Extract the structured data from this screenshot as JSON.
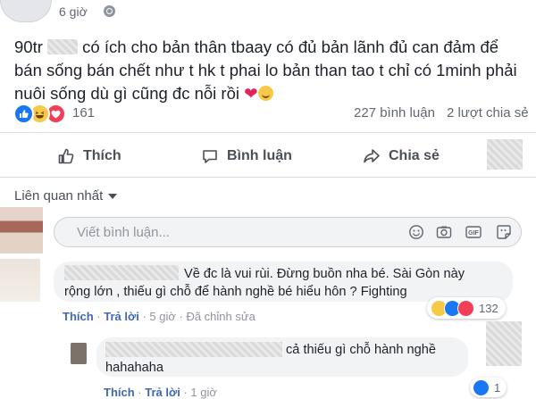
{
  "post": {
    "time": "6 giờ",
    "text_prefix": "90tr",
    "text_mid": "có ích cho bản thân tbaay có đủ bản lãnh đủ can đảm để bán sống bán chết như t hk t phai lo bản than tao t chỉ có 1minh phải nuôi sống dù gì cũng đc nỗi rồi",
    "heart": "❤",
    "reaction_count": "161",
    "comment_count": "227 bình luận",
    "share_count": "2 lượt chia sẻ"
  },
  "actions": {
    "like": "Thích",
    "comment": "Bình luận",
    "share": "Chia sẻ"
  },
  "filter": {
    "label": "Liên quan nhất"
  },
  "composer": {
    "placeholder": "Viết bình luận..."
  },
  "comments": [
    {
      "text": "Về đc là vui rùi. Đừng buồn nha bé. Sài Gòn này rộng lớn , thiếu gì chỗ để hành nghề bé hiểu hôn ? Fighting",
      "like": "Thích",
      "reply": "Trả lời",
      "time": "5 giờ",
      "edited": "Đã chỉnh sửa",
      "reaction_count": "132"
    },
    {
      "text": "cả thiếu gì chỗ hành nghề hahahaha",
      "like": "Thích",
      "reply": "Trả lời",
      "time": "1 giờ",
      "reaction_count": "1"
    }
  ],
  "colors": {
    "like_blue": "#1877f2",
    "love_red": "#f33e58",
    "haha_yellow": "#f7c948",
    "link_blue": "#4267b2"
  },
  "icons": [
    "globe-icon",
    "thumbs-up-icon",
    "comment-bubble-icon",
    "share-arrow-icon",
    "emoji-icon",
    "camera-icon",
    "gif-icon",
    "sticker-icon",
    "caret-down-icon"
  ]
}
